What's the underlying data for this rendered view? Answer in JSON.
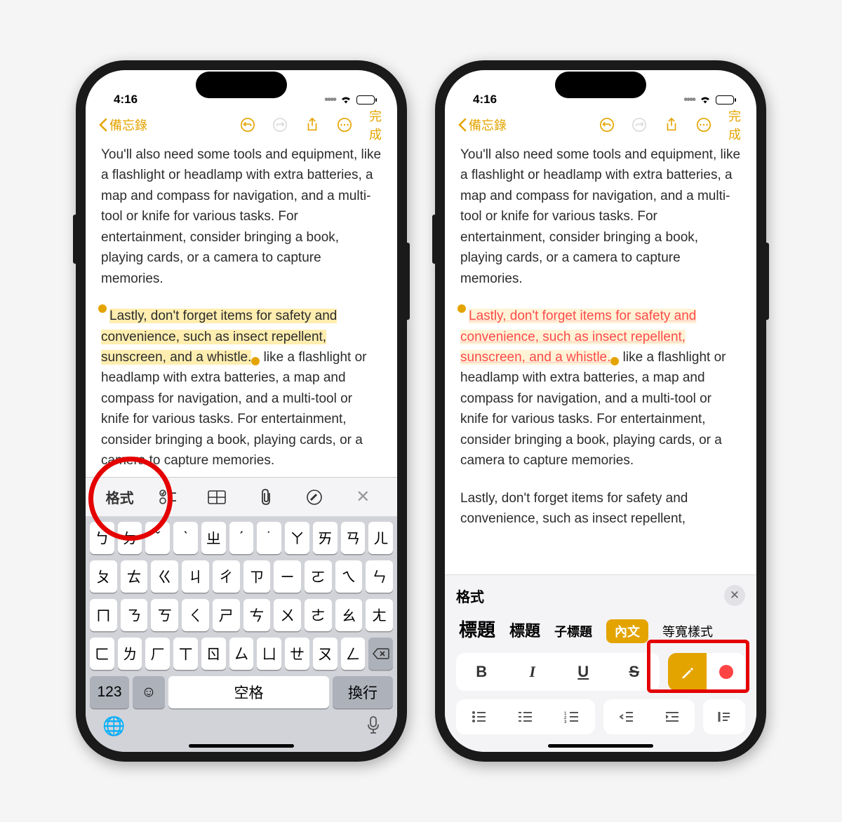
{
  "status": {
    "time": "4:16"
  },
  "nav": {
    "back": "備忘錄",
    "done": "完成"
  },
  "note": {
    "p1": "You'll also need some tools and equipment, like a flashlight or headlamp with extra batteries, a map and compass for navigation, and a multi-tool or knife for various tasks. For entertainment, consider bringing a book, playing cards, or a camera to capture memories.",
    "sel": "Lastly, don't forget items for safety and convenience, such as insect repellent, sunscreen, and a whistle.",
    "p2_rest": " like a flashlight or headlamp with extra batteries, a map and compass for navigation, and a multi-tool or knife for various tasks. For entertainment, consider bringing a book, playing cards, or a camera to capture memories.",
    "p3": "Lastly, don't forget items for safety and convenience, such as insect repellent,"
  },
  "toolbar": {
    "format": "格式"
  },
  "keyboard": {
    "row1": [
      "ㄅ",
      "ㄉ",
      "ˇ",
      "ˋ",
      "ㄓ",
      "ˊ",
      "˙",
      "ㄚ",
      "ㄞ",
      "ㄢ",
      "ㄦ"
    ],
    "row2": [
      "ㄆ",
      "ㄊ",
      "ㄍ",
      "ㄐ",
      "ㄔ",
      "ㄗ",
      "ㄧ",
      "ㄛ",
      "ㄟ",
      "ㄣ"
    ],
    "row3": [
      "ㄇ",
      "ㄋ",
      "ㄎ",
      "ㄑ",
      "ㄕ",
      "ㄘ",
      "ㄨ",
      "ㄜ",
      "ㄠ",
      "ㄤ"
    ],
    "row4": [
      "ㄈ",
      "ㄌ",
      "ㄏ",
      "ㄒ",
      "ㄖ",
      "ㄙ",
      "ㄩ",
      "ㄝ",
      "ㄡ",
      "ㄥ"
    ],
    "num": "123",
    "space": "空格",
    "return": "換行"
  },
  "format_panel": {
    "title": "格式",
    "styles": [
      "標題",
      "標題",
      "子標題",
      "內文",
      "等寬樣式"
    ],
    "b": "B",
    "i": "I",
    "u": "U",
    "s": "S"
  }
}
